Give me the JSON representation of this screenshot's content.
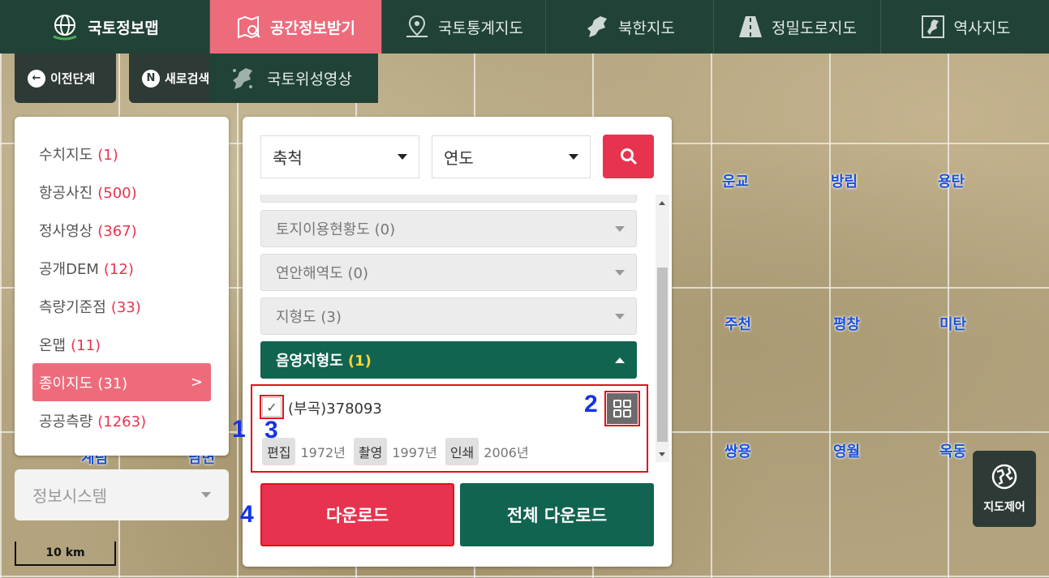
{
  "topnav": {
    "logo": "국토정보맵",
    "items": [
      "공간정보받기",
      "국토통계지도",
      "북한지도",
      "정밀도로지도",
      "역사지도"
    ],
    "sub_item": "국토위성영상"
  },
  "toolbar": {
    "prev": "이전단계",
    "new_search": "새로검색"
  },
  "map": {
    "places": [
      "운교",
      "방림",
      "용탄",
      "주천",
      "평창",
      "미탄",
      "쌍용",
      "영월",
      "옥동",
      "계림",
      "남면"
    ],
    "control_label": "지도제어",
    "scale_label": "10 km"
  },
  "left_panel": {
    "items": [
      {
        "label": "수치지도",
        "count": "(1)"
      },
      {
        "label": "항공사진",
        "count": "(500)"
      },
      {
        "label": "정사영상",
        "count": "(367)"
      },
      {
        "label": "공개DEM",
        "count": "(12)"
      },
      {
        "label": "측량기준점",
        "count": "(33)"
      },
      {
        "label": "온맵",
        "count": "(11)"
      },
      {
        "label": "종이지도",
        "count": "(31)"
      },
      {
        "label": "공공측량",
        "count": "(1263)"
      }
    ],
    "selected_arrow": ">",
    "system": "정보시스템"
  },
  "panel": {
    "scale_select": "축척",
    "year_select": "연도",
    "accordions": [
      {
        "label": "토지이용현황도 (0)"
      },
      {
        "label": "연안해역도 (0)"
      },
      {
        "label": "지형도 (3)"
      }
    ],
    "open_accordion": {
      "label": "음영지형도",
      "count": "(1)"
    },
    "record": {
      "check": "✓",
      "title": "(부곡)378093",
      "edit_tag": "편집",
      "edit_year": "1972년",
      "shot_tag": "촬영",
      "shot_year": "1997년",
      "print_tag": "인쇄",
      "print_year": "2006년"
    },
    "download": "다운로드",
    "download_all": "전체 다운로드"
  },
  "annotations": [
    "1",
    "2",
    "3",
    "4"
  ],
  "colors": {
    "nav_bg": "#214237",
    "accent_pink": "#ee6b7b",
    "accent_red": "#e8334f",
    "green": "#116450",
    "highlight_yellow": "#ffd43a",
    "annot_blue": "#1433e8",
    "outline_red": "#e0131b"
  }
}
